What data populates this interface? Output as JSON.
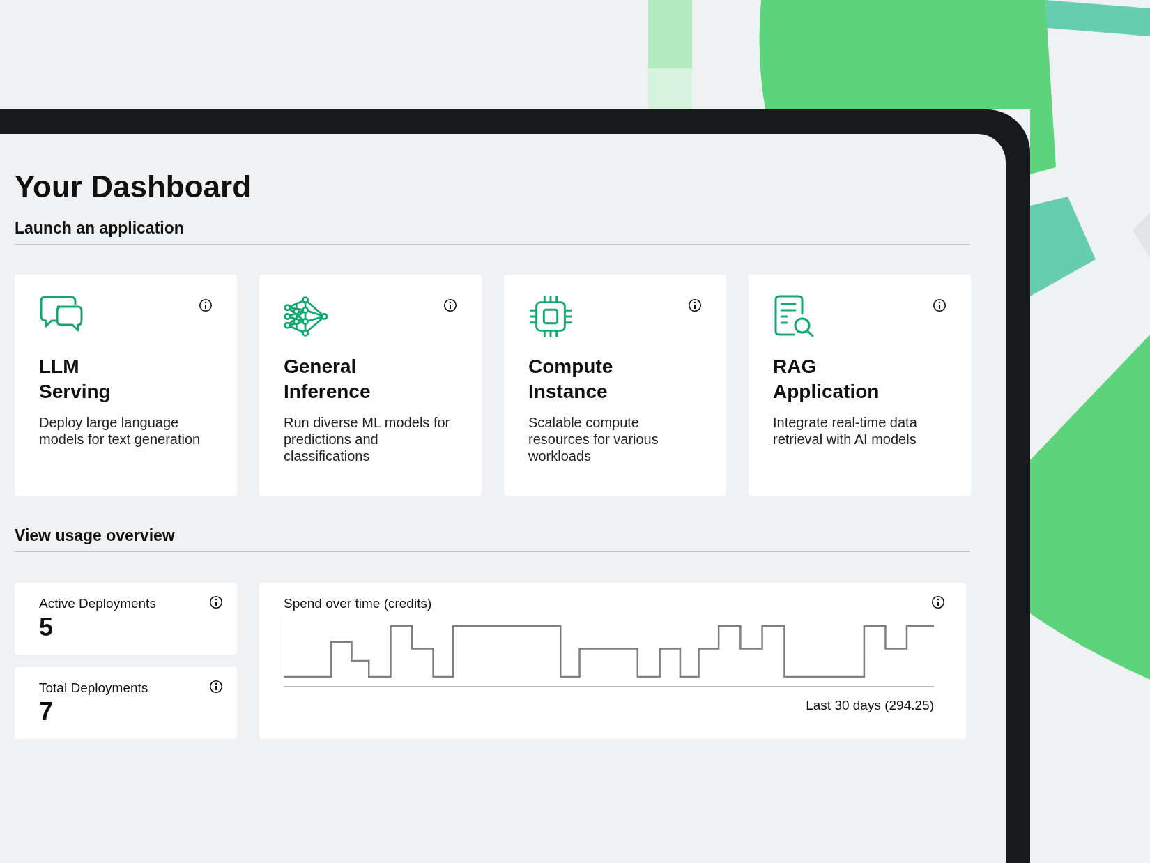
{
  "title": "Your Dashboard",
  "launch_section": {
    "heading": "Launch an application",
    "apps": [
      {
        "kind": "chat",
        "title": "LLM Serving",
        "description": "Deploy large language models for text generation"
      },
      {
        "kind": "network",
        "title": "General Inference",
        "description": "Run diverse ML models for predictions and classifications"
      },
      {
        "kind": "chip",
        "title": "Compute Instance",
        "description": "Scalable compute resources for various workloads"
      },
      {
        "kind": "document",
        "title": "RAG Application",
        "description": "Integrate real-time data retrieval with AI models"
      }
    ]
  },
  "usage_section": {
    "heading": "View usage overview",
    "stats": [
      {
        "label": "Active Deployments",
        "value": "5"
      },
      {
        "label": "Total Deployments",
        "value": "7"
      }
    ],
    "spend_chart": {
      "title": "Spend over time (credits)",
      "caption": "Last 30 days (294.25)"
    }
  }
}
